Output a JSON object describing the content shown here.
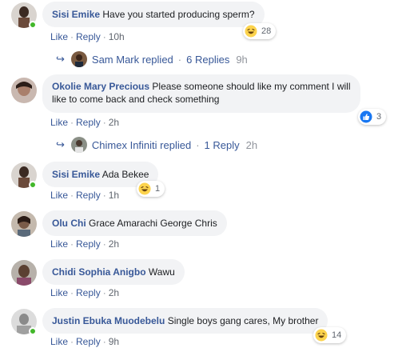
{
  "comments": [
    {
      "name": "Sisi Emike",
      "text": "Have you started producing sperm?",
      "actions": {
        "like": "Like",
        "reply": "Reply",
        "time": "10h"
      },
      "reaction": {
        "icon": "haha-emoji-icon",
        "count": "28"
      },
      "online": true,
      "replies": {
        "author": "Sam Mark replied",
        "count": "6 Replies",
        "time": "9h"
      }
    },
    {
      "name": "Okolie Mary Precious",
      "text_line1": "Please someone should like my comment I will",
      "text_line2": "like to come back and check something",
      "actions": {
        "like": "Like",
        "reply": "Reply",
        "time": "2h"
      },
      "reaction": {
        "icon": "like-thumb-icon",
        "count": "3"
      },
      "online": false,
      "replies": {
        "author": "Chimex Infiniti replied",
        "count": "1 Reply",
        "time": "2h"
      }
    },
    {
      "name": "Sisi Emike",
      "text": "Ada Bekee",
      "actions": {
        "like": "Like",
        "reply": "Reply",
        "time": "1h"
      },
      "reaction": {
        "icon": "haha-emoji-icon",
        "count": "1"
      },
      "online": true
    },
    {
      "name": "Olu Chi",
      "text": "Grace Amarachi George Chris",
      "actions": {
        "like": "Like",
        "reply": "Reply",
        "time": "2h"
      },
      "online": false
    },
    {
      "name": "Chidi Sophia Anigbo",
      "text": "Wawu",
      "actions": {
        "like": "Like",
        "reply": "Reply",
        "time": "2h"
      },
      "online": false
    },
    {
      "name": "Justin Ebuka Muodebelu",
      "text": "Single boys gang cares, My brother",
      "actions": {
        "like": "Like",
        "reply": "Reply",
        "time": "9h"
      },
      "reaction": {
        "icon": "haha-emoji-icon",
        "count": "14"
      },
      "online": true
    }
  ],
  "colors": {
    "name": "#385898",
    "bubble": "#f2f3f5",
    "online": "#42b72a",
    "meta": "#616770"
  }
}
